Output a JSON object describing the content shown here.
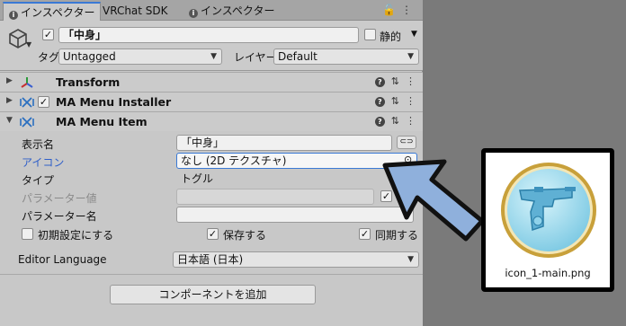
{
  "tabs": [
    {
      "label": "インスペクター",
      "active": true
    },
    {
      "label": "VRChat SDK",
      "active": false
    },
    {
      "label": "インスペクター",
      "active": false
    }
  ],
  "gameobject": {
    "active_checked": true,
    "name": "「中身」",
    "static_label": "静的",
    "tag_label": "タグ",
    "tag_value": "Untagged",
    "layer_label": "レイヤー",
    "layer_value": "Default"
  },
  "components": [
    {
      "title": "Transform",
      "expanded": false,
      "has_checkbox": false,
      "icon": "transform-icon"
    },
    {
      "title": "MA Menu Installer",
      "expanded": false,
      "has_checkbox": true,
      "icon": "ma-icon"
    },
    {
      "title": "MA Menu Item",
      "expanded": true,
      "has_checkbox": false,
      "icon": "ma-icon"
    }
  ],
  "menu_item": {
    "display_name_label": "表示名",
    "display_name_value": "「中身」",
    "icon_label": "アイコン",
    "icon_value": "なし (2D テクスチャ)",
    "type_label": "タイプ",
    "type_value": "トグル",
    "param_value_label": "パラメーター値",
    "param_name_label": "パラメーター名",
    "initial_label": "初期設定にする",
    "initial_checked": false,
    "saved_label": "保存する",
    "saved_checked": true,
    "synced_label": "同期する",
    "synced_checked": true,
    "editor_language_label": "Editor Language",
    "editor_language_value": "日本語 (日本)"
  },
  "add_component_label": "コンポーネントを追加",
  "preview": {
    "caption": "icon_1-main.png",
    "icon": "water-gun-icon"
  },
  "colors": {
    "accent_blue": "#2f5fc9",
    "arrow_fill": "#8fb0dc",
    "ball_gold": "#c8a03a",
    "ball_blue": "#9fd9ee"
  }
}
